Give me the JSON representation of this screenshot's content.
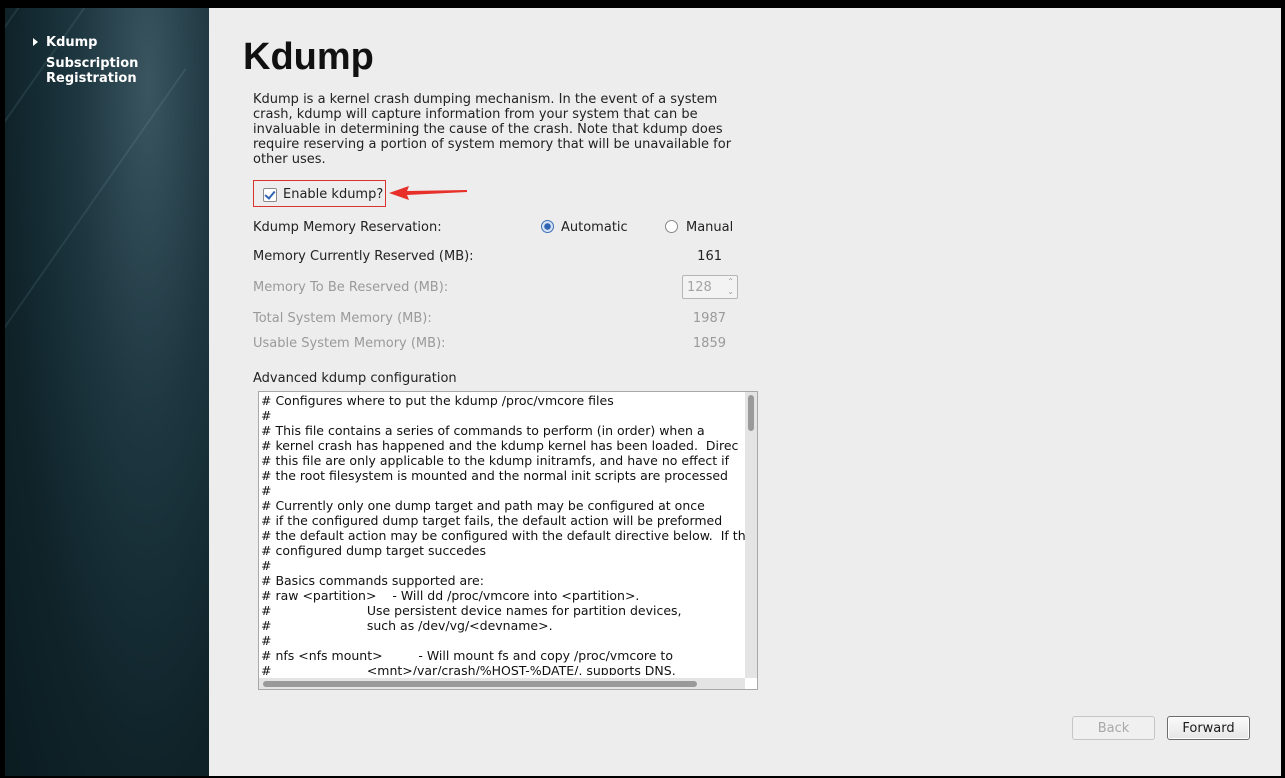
{
  "sidebar": {
    "items": [
      {
        "label": "Kdump",
        "active": true
      },
      {
        "label": "Subscription\nRegistration",
        "active": false
      }
    ]
  },
  "page": {
    "title": "Kdump",
    "description": "Kdump is a kernel crash dumping mechanism. In the event of a system crash, kdump will capture information from your system that can be invaluable in determining the cause of the crash. Note that kdump does require reserving a portion of system memory that will be unavailable for other uses."
  },
  "enable": {
    "label": "Enable kdump?",
    "checked": true
  },
  "reservation": {
    "label": "Kdump Memory Reservation:",
    "options": [
      {
        "label": "Automatic",
        "selected": true
      },
      {
        "label": "Manual",
        "selected": false
      }
    ]
  },
  "memory": {
    "currently_reserved_label": "Memory Currently Reserved (MB):",
    "currently_reserved_value": "161",
    "to_be_reserved_label": "Memory To Be Reserved (MB):",
    "to_be_reserved_value": "128",
    "total_label": "Total System Memory (MB):",
    "total_value": "1987",
    "usable_label": "Usable System Memory (MB):",
    "usable_value": "1859"
  },
  "advanced": {
    "label": "Advanced kdump configuration",
    "lines": [
      "# Configures where to put the kdump /proc/vmcore files",
      "#",
      "# This file contains a series of commands to perform (in order) when a",
      "# kernel crash has happened and the kdump kernel has been loaded.  Direc",
      "# this file are only applicable to the kdump initramfs, and have no effect if",
      "# the root filesystem is mounted and the normal init scripts are processed",
      "#",
      "# Currently only one dump target and path may be configured at once",
      "# if the configured dump target fails, the default action will be preformed",
      "# the default action may be configured with the default directive below.  If th",
      "# configured dump target succedes",
      "#",
      "# Basics commands supported are:",
      "# raw <partition>    - Will dd /proc/vmcore into <partition>.",
      "#                        Use persistent device names for partition devices,",
      "#                        such as /dev/vg/<devname>.",
      "#",
      "# nfs <nfs mount>         - Will mount fs and copy /proc/vmcore to",
      "#                        <mnt>/var/crash/%HOST-%DATE/, supports DNS."
    ]
  },
  "buttons": {
    "back": "Back",
    "forward": "Forward"
  },
  "colors": {
    "highlight": "#d9342b",
    "accent": "#2f64b3"
  }
}
